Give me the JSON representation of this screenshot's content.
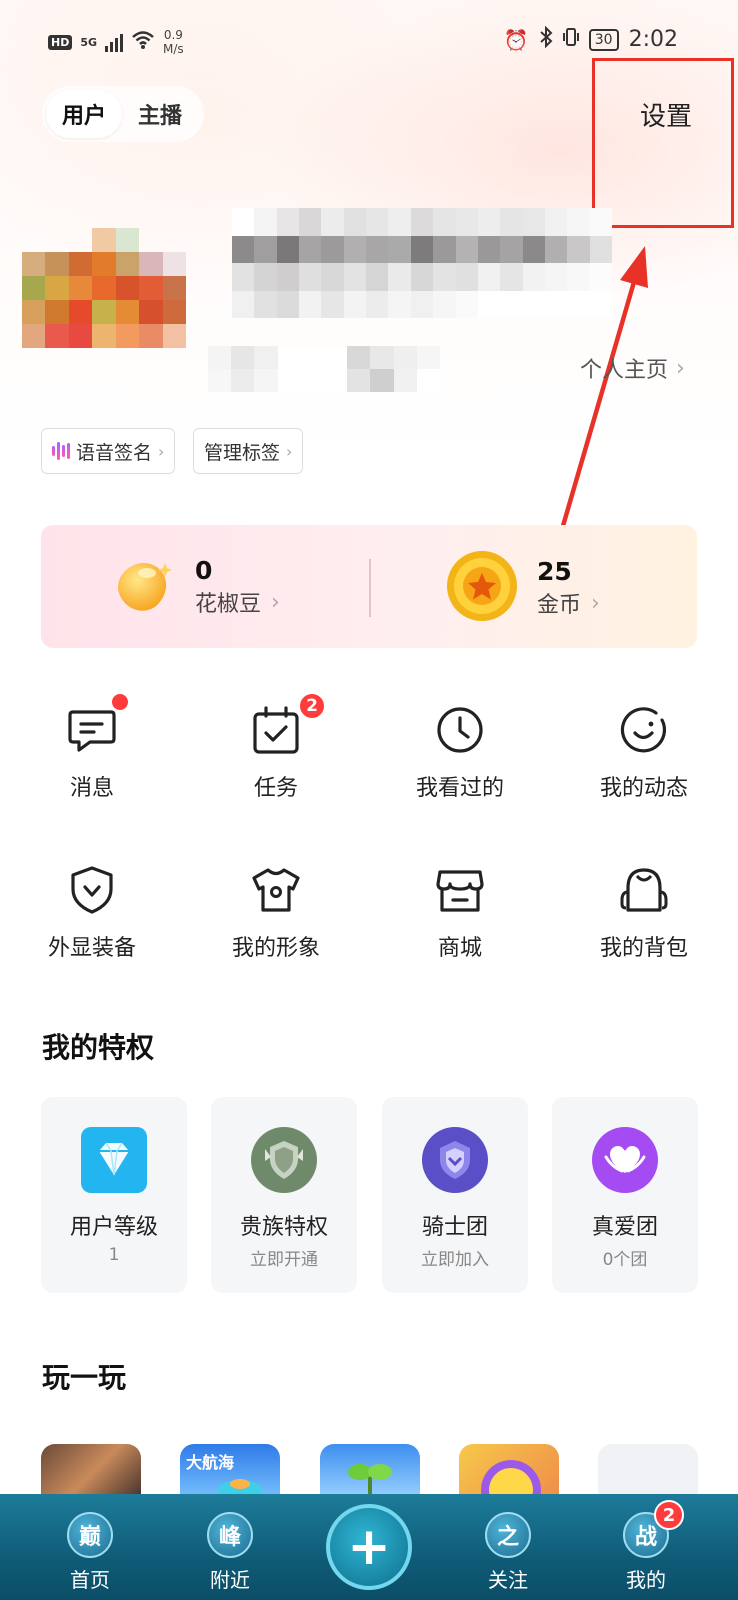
{
  "status_bar": {
    "hd": "HD",
    "network": "5G",
    "speed_value": "0.9",
    "speed_unit": "M/s",
    "battery": "30",
    "time": "2:02"
  },
  "header": {
    "tabs": [
      {
        "label": "用户",
        "active": true
      },
      {
        "label": "主播",
        "active": false
      }
    ],
    "settings_label": "设置"
  },
  "profile": {
    "homepage_link": "个人主页"
  },
  "tags": [
    {
      "label": "语音签名",
      "icon": "voice-wave-icon"
    },
    {
      "label": "管理标签",
      "icon": null
    }
  ],
  "wallet": {
    "beans": {
      "value": "0",
      "label": "花椒豆",
      "icon": "bean-icon"
    },
    "coins": {
      "value": "25",
      "label": "金币",
      "icon": "coin-icon"
    }
  },
  "quick_actions": [
    {
      "label": "消息",
      "icon": "message-icon",
      "dot": true
    },
    {
      "label": "任务",
      "icon": "task-icon",
      "badge": "2"
    },
    {
      "label": "我看过的",
      "icon": "history-clock-icon"
    },
    {
      "label": "我的动态",
      "icon": "moments-icon"
    },
    {
      "label": "外显装备",
      "icon": "shield-icon"
    },
    {
      "label": "我的形象",
      "icon": "tshirt-icon"
    },
    {
      "label": "商城",
      "icon": "store-icon"
    },
    {
      "label": "我的背包",
      "icon": "backpack-icon"
    }
  ],
  "privileges": {
    "title": "我的特权",
    "items": [
      {
        "label": "用户等级",
        "sub": "1",
        "icon": "diamond-icon",
        "color": "#1bb6f0"
      },
      {
        "label": "贵族特权",
        "sub": "立即开通",
        "icon": "noble-shield-icon",
        "color": "#6f8a6a"
      },
      {
        "label": "骑士团",
        "sub": "立即加入",
        "icon": "knight-shield-icon",
        "color": "#6a5cd6"
      },
      {
        "label": "真爱团",
        "sub": "0个团",
        "icon": "heart-hands-icon",
        "color": "#a24ef0"
      }
    ]
  },
  "games": {
    "title": "玩一玩"
  },
  "bottom_nav": {
    "items": [
      {
        "label": "首页",
        "glyph": "巅"
      },
      {
        "label": "附近",
        "glyph": "峰"
      },
      {
        "label": "关注",
        "glyph": "之"
      },
      {
        "label": "我的",
        "glyph": "战",
        "badge": "2"
      }
    ],
    "plus": "+"
  },
  "colors": {
    "accent_red": "#e83227",
    "badge_red": "#ff3b3b",
    "nav_bg": "#0f5c78"
  }
}
